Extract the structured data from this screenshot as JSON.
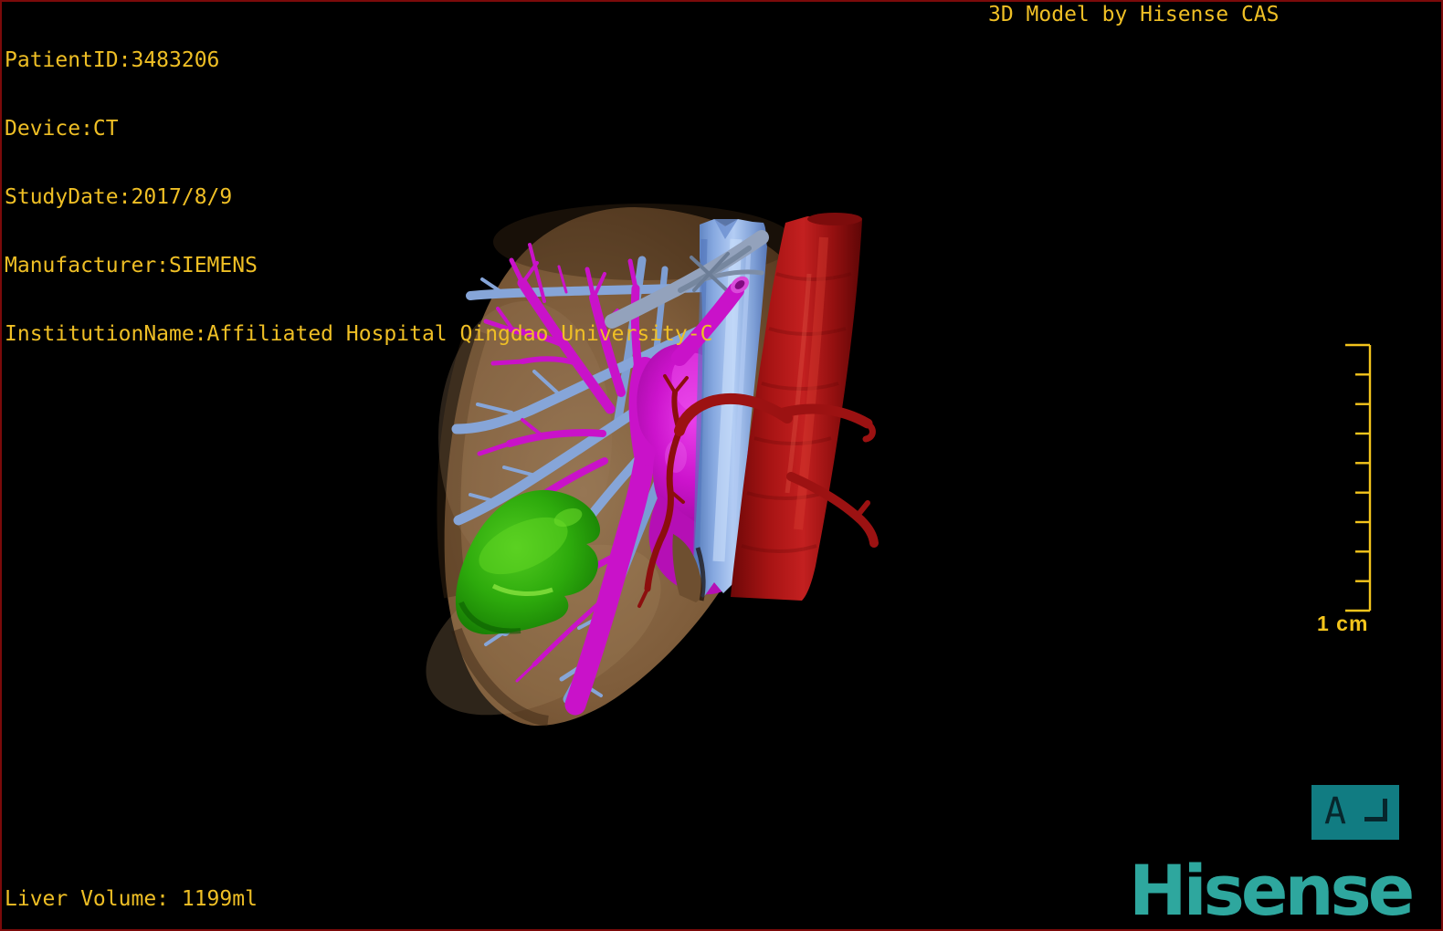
{
  "header": {
    "patient_info": [
      "PatientID:3483206",
      "Device:CT",
      "StudyDate:2017/8/9",
      "Manufacturer:SIEMENS",
      "InstitutionName:Affiliated Hospital Qingdao University-C"
    ],
    "watermark_title": "3D Model by Hisense CAS"
  },
  "footer": {
    "liver_volume": "Liver Volume: 1199ml",
    "brand": "Hisense"
  },
  "scale_bar": {
    "label": "1 cm",
    "tick_count": 10
  },
  "orientation_marker": {
    "letter": "A",
    "icon": "corner-bracket-icon"
  },
  "model": {
    "structures": [
      "liver",
      "portal-vein",
      "hepatic-vein",
      "inferior-vena-cava",
      "aorta",
      "hepatic-artery",
      "gallbladder"
    ],
    "colors": {
      "liver": "#8a6a48",
      "portal_vein": "#c912c9",
      "hepatic_vein": "#86a5d8",
      "inferior_vena_cava": "#9dbcee",
      "artery": "#b01414",
      "gallbladder": "#2faa0e"
    }
  },
  "colors": {
    "overlay_text": "#efbf25",
    "scale_bar": "#f3c41c",
    "frame_border": "#7c0a0a",
    "orientation_box": "#117c82",
    "brand_teal": "#2ea79e",
    "background": "#000000"
  }
}
